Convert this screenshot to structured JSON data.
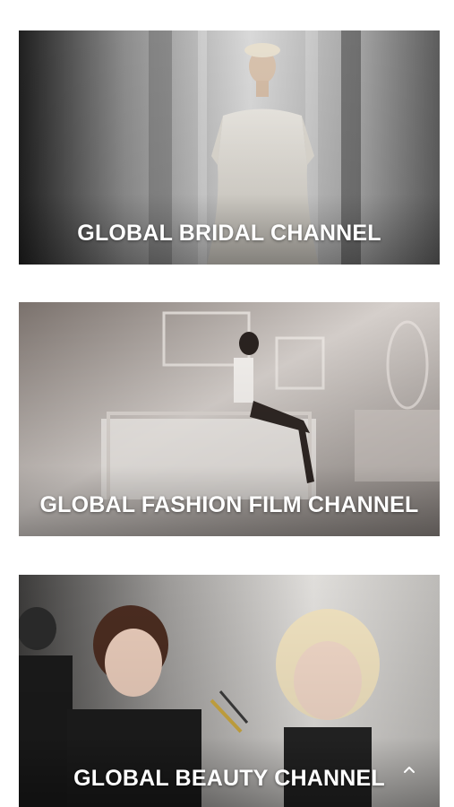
{
  "channels": [
    {
      "title": "GLOBAL BRIDAL CHANNEL"
    },
    {
      "title": "GLOBAL FASHION FILM CHANNEL"
    },
    {
      "title": "GLOBAL BEAUTY CHANNEL"
    }
  ],
  "icons": {
    "scroll_top": "chevron-up-icon"
  },
  "colors": {
    "background": "#ffffff",
    "title_text": "#ffffff"
  }
}
